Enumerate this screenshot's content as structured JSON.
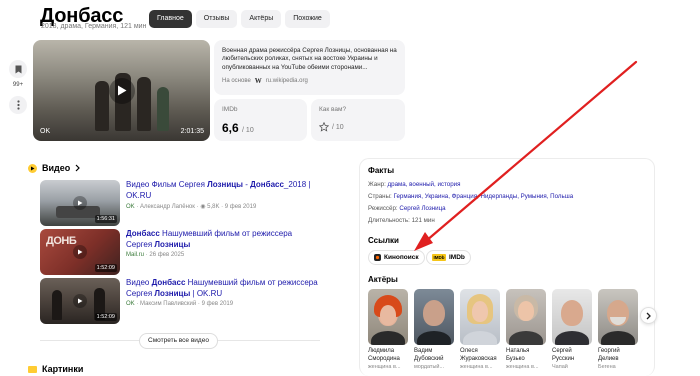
{
  "header": {
    "title": "Донбасс",
    "subtitle": "2018, драма, Германия, 121 мин",
    "tabs": [
      {
        "label": "Главное",
        "active": true
      },
      {
        "label": "Отзывы",
        "active": false
      },
      {
        "label": "Актёры",
        "active": false
      },
      {
        "label": "Похожие",
        "active": false
      }
    ]
  },
  "sidebar": {
    "bookmark_count": "99+"
  },
  "main_video": {
    "source": "OK",
    "duration": "2:01:35"
  },
  "description": {
    "text": "Военная драма режиссёра Сергея Лозницы, основанная на любительских роликах, снятых на востоке Украины и опубликованных на YouTube обеими сторонами...",
    "source_prefix": "На основе",
    "source_icon": "W",
    "source_name": "ru.wikipedia.org"
  },
  "imdb_card": {
    "label": "IMDb",
    "rating": "6,6",
    "scale": "/ 10"
  },
  "user_card": {
    "label": "Как вам?",
    "scale": "/ 10"
  },
  "videos_section": {
    "title": "Видео",
    "items": [
      {
        "title_plain1": "Видео Фильм Сергея ",
        "title_bold1": "Лозницы",
        "title_plain2": " - ",
        "title_bold2": "Донбасс",
        "title_plain3": "_2018 | OK.RU",
        "source": "OK",
        "author": "Александр Лапёнок",
        "views": "5,8K",
        "date": "9 фев 2019",
        "duration": "1:56:31"
      },
      {
        "title_bold1": "Донбасс",
        "title_plain1": " Нашумевший фильм от режиссера Сергея ",
        "title_bold2": "Лозницы",
        "source": "Mail.ru",
        "date": "26 фев 2025",
        "duration": "1:52:09"
      },
      {
        "title_plain1": "Видео ",
        "title_bold1": "Донбасс",
        "title_plain2": " Нашумевший фильм от режиссера Сергея ",
        "title_bold2": "Лозницы",
        "title_plain3": " | OK.RU",
        "source": "OK",
        "author": "Максим Павливский",
        "date": "9 фев 2019",
        "duration": "1:52:09"
      }
    ],
    "more_label": "Смотреть все видео"
  },
  "facts": {
    "title": "Факты",
    "genre_label": "Жанр:",
    "genre_value": "драма, военный, история",
    "countries_label": "Страны:",
    "countries_value": "Германия, Украина, Франция, Нидерланды, Румыния, Польша",
    "director_label": "Режиссёр:",
    "director_value": "Сергей Лозница",
    "duration_label": "Длительность:",
    "duration_value": "121 мин"
  },
  "links": {
    "title": "Ссылки",
    "items": [
      {
        "label": "Кинопоиск"
      },
      {
        "label": "IMDb",
        "logo": "IMDb"
      }
    ]
  },
  "actors": {
    "title": "Актёры",
    "items": [
      {
        "name1": "Людмила",
        "name2": "Смородина",
        "role": "женщина в..."
      },
      {
        "name1": "Вадим",
        "name2": "Дубовский",
        "role": "мордатый..."
      },
      {
        "name1": "Олеся",
        "name2": "Жураковская",
        "role": "женщина в..."
      },
      {
        "name1": "Наталья",
        "name2": "Бузько",
        "role": "женщина в..."
      },
      {
        "name1": "Сергей",
        "name2": "Русскин",
        "role": "Чапай"
      },
      {
        "name1": "Георгий",
        "name2": "Делиев",
        "role": "Бегена"
      }
    ]
  },
  "pictures_section": {
    "title": "Картинки"
  },
  "colors": {
    "link": "#1d1aab",
    "arrow": "#e02020",
    "accent_yellow": "#ffcc33",
    "tab_active": "#333333"
  }
}
